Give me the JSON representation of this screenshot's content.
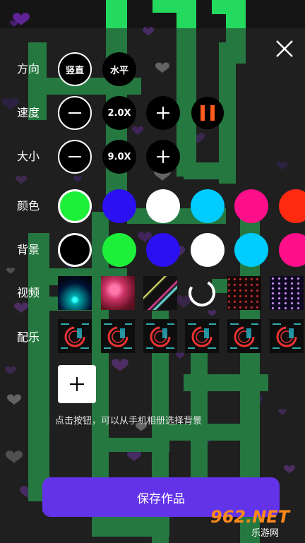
{
  "panel": {
    "close_icon": "close-icon",
    "direction": {
      "label": "方向",
      "options": [
        "竖直",
        "水平"
      ],
      "selected": "竖直"
    },
    "speed": {
      "label": "速度",
      "value": "2.0X",
      "playback_state": "playing"
    },
    "size": {
      "label": "大小",
      "value": "9.0X"
    },
    "color": {
      "label": "颜色",
      "swatches": [
        "#1ef039",
        "#2b10f2",
        "#ffffff",
        "#00ccff",
        "#ff0f8a",
        "#ff2a10"
      ],
      "selected_index": 0
    },
    "background": {
      "label": "背景",
      "swatches": [
        "#000000",
        "#1ef039",
        "#2b10f2",
        "#ffffff",
        "#00ccff",
        "#ff0f8a"
      ],
      "selected_index": 0
    },
    "video": {
      "label": "视频",
      "thumbnails": [
        "blue-burst",
        "pink-bokeh",
        "neon-lines",
        "loading-spinner",
        "red-dots",
        "purple-sparkles"
      ]
    },
    "music": {
      "label": "配乐",
      "tracks": [
        "music-1",
        "music-2",
        "music-3",
        "music-4",
        "music-5",
        "music-6"
      ]
    },
    "custom_background_hint": "点击按钮，可以从手机相册选择背景",
    "save_label": "保存作品"
  },
  "watermark": {
    "logo": "962.NET",
    "subtitle": "乐游网"
  },
  "colors": {
    "neon_text": "#23d95e",
    "save_button": "#6333e9",
    "pause": "#ff5a1f"
  }
}
